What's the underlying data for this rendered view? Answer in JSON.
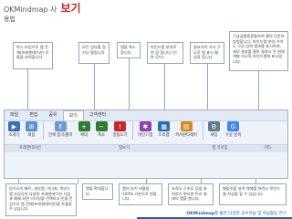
{
  "header": {
    "title_prefix": "OKMindmap 사",
    "title_main": "보기",
    "subtitle": "용법"
  },
  "menus": [
    "파일",
    "편집",
    "공유",
    "보기",
    "고객센터"
  ],
  "active_menu_index": 3,
  "tools": [
    {
      "label": "소개기",
      "icon": "slideshow-icon",
      "color": "#3b6fb6"
    },
    {
      "label": "펴짐",
      "icon": "expand-icon",
      "color": "#5a8fd6"
    },
    {
      "label": "전체 접기/펼치",
      "icon": "collapse-all-icon",
      "color": "#6b9bd1"
    },
    {
      "label": "확대",
      "icon": "zoom-in-icon",
      "color": "#2e7d32"
    },
    {
      "label": "축소",
      "icon": "zoom-out-icon",
      "color": "#2e7d32"
    },
    {
      "label": "알림도기",
      "icon": "alert-icon",
      "color": "#c62828"
    },
    {
      "label": "마인드맵",
      "icon": "mindmap-icon",
      "color": "#8e44ad"
    },
    {
      "label": "트리맵",
      "icon": "treemap-icon",
      "color": "#2a6fb0"
    },
    {
      "label": "퍼셔판타레이",
      "icon": "padlet-icon",
      "color": "#d28b1e"
    },
    {
      "label": "세팅",
      "icon": "settings-icon",
      "color": "#607d8b"
    },
    {
      "label": "구글 검색",
      "icon": "google-search-icon",
      "color": "#4285f4"
    }
  ],
  "groups": [
    "프레젠테이션",
    "",
    "맵보기",
    "",
    "맵 유저밈",
    "기타"
  ],
  "callouts": {
    "top1": "박스 타입으로 맵 전체(프레젠테이션) 흐름을 보여줍니다.",
    "top2": "모든 섬다를 접거나 펼칩니다.",
    "top3": "맵을 축소합니다.",
    "top4": "마인드맵 분야로 변 경 합니다 (기본 모드).",
    "top5": "필요가의 가사 구도로 맵 표시 활성화 합니다.",
    "top6": "구글글맵종을통하여 웹의 단준어 방영합니다. 마인드맵 분야 수마도 구글 검색 결과를 표시하여, 세부 결과를 웹보 결과시 된 위에 개별 저시작 마인드맵에 표시합니다.",
    "bottom1": "다이나믹 빠르, 세부맵, 이너포, 마인드 맵 조감모의 다양한 프레젠테이션 사업과 예제 화면 스타일을 선택하고 인물 문 업으로 맵 전체(프레젠테이션)을 토출할 수 있습니다.",
    "bottom2": "맵을 확대합니다.",
    "bottom3": "맵의 보기 비율을 100% 기본으로 변합니다.",
    "bottom4": "조직도 구조도 등을 표현하기 편리한 트리 형태의 맵을 봅니다.",
    "bottom5": "패들릿을 살려 웨메를 마련시 유인드웹 작성을 할 수 있습니다."
  },
  "footer": {
    "brand": "OKMindmap",
    "text": "를 통한 다양한 교수학습 및 학습활동 연구"
  }
}
